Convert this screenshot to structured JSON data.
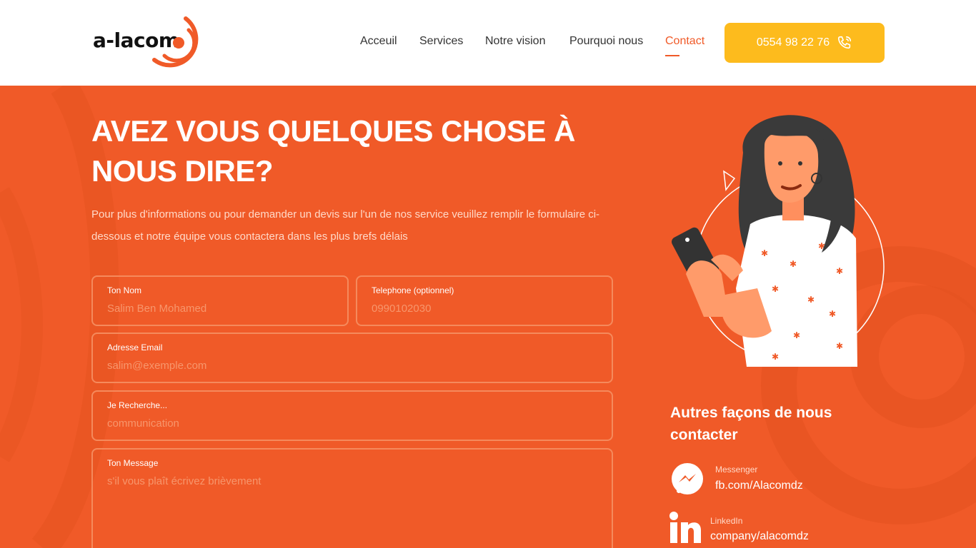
{
  "brand": {
    "logo_text": "a-lacom",
    "accent": "#f05a28",
    "cta_color": "#fdbb1d"
  },
  "nav": {
    "items": [
      {
        "label": "Acceuil"
      },
      {
        "label": "Services"
      },
      {
        "label": "Notre vision"
      },
      {
        "label": "Pourquoi nous"
      },
      {
        "label": "Contact",
        "active": true
      }
    ],
    "phone": {
      "label": "0554 98 22 76",
      "icon": "phone-icon"
    }
  },
  "hero": {
    "title_line1": "AVEZ VOUS QUELQUES CHOSE À",
    "title_line2": "NOUS DIRE?",
    "intro": "Pour plus d'informations ou pour demander un devis sur l'un de nos service veuillez remplir le formulaire ci-dessous et notre équipe vous contactera dans les plus brefs délais"
  },
  "form": {
    "name": {
      "label": "Ton Nom",
      "placeholder": "Salim Ben Mohamed",
      "value": ""
    },
    "phone": {
      "label": "Telephone (optionnel)",
      "placeholder": "0990102030",
      "value": ""
    },
    "email": {
      "label": "Adresse Email",
      "placeholder": "salim@exemple.com",
      "value": ""
    },
    "search": {
      "label": "Je Recherche...",
      "placeholder": "communication",
      "value": ""
    },
    "message": {
      "label": "Ton Message",
      "placeholder": "s'il vous plaît écrivez brièvement",
      "value": ""
    }
  },
  "other_contacts": {
    "title": "Autres façons de nous contacter",
    "items": [
      {
        "label": "Messenger",
        "value": "fb.com/Alacomdz",
        "icon": "messenger-icon"
      },
      {
        "label": "LinkedIn",
        "value": "company/alacomdz",
        "icon": "linkedin-icon"
      }
    ]
  }
}
